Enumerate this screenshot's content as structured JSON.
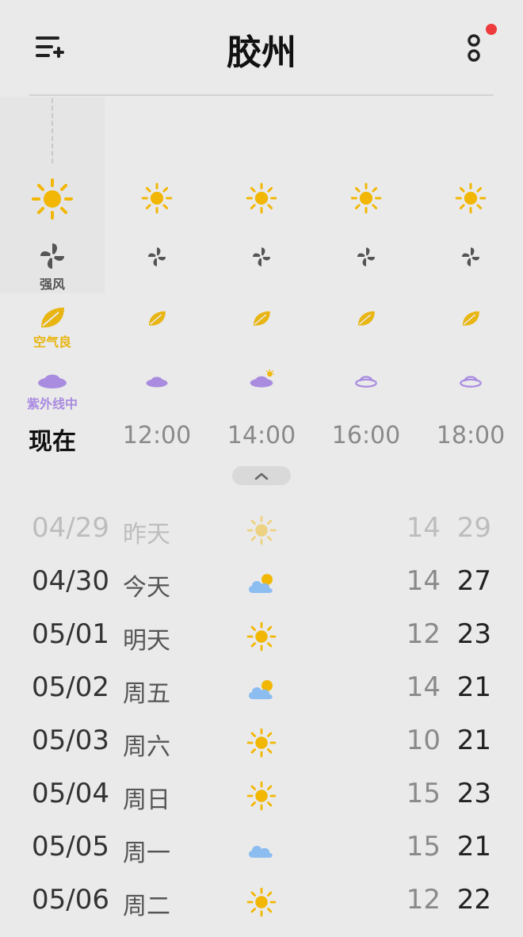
{
  "app": {
    "city": "胶州"
  },
  "hourly": [
    {
      "time": "现在",
      "wind": "强风",
      "air": "空气良",
      "uv": "紫外线中"
    },
    {
      "time": "12:00"
    },
    {
      "time": "14:00"
    },
    {
      "time": "16:00"
    },
    {
      "time": "18:00"
    }
  ],
  "daily": [
    {
      "date": "04/29",
      "day": "昨天",
      "icon": "sun-icon",
      "low": "14",
      "high": "29"
    },
    {
      "date": "04/30",
      "day": "今天",
      "icon": "cloud-sun-icon",
      "low": "14",
      "high": "27"
    },
    {
      "date": "05/01",
      "day": "明天",
      "icon": "sun-icon",
      "low": "12",
      "high": "23"
    },
    {
      "date": "05/02",
      "day": "周五",
      "icon": "cloud-sun-icon",
      "low": "14",
      "high": "21"
    },
    {
      "date": "05/03",
      "day": "周六",
      "icon": "sun-icon",
      "low": "10",
      "high": "21"
    },
    {
      "date": "05/04",
      "day": "周日",
      "icon": "sun-icon",
      "low": "15",
      "high": "23"
    },
    {
      "date": "05/05",
      "day": "周一",
      "icon": "cloud-icon",
      "low": "15",
      "high": "21"
    },
    {
      "date": "05/06",
      "day": "周二",
      "icon": "sun-icon",
      "low": "12",
      "high": "22"
    }
  ],
  "colors": {
    "sun": "#f2b705",
    "cloud": "#8cbdf0",
    "leaf": "#e8b512",
    "uv": "#a98ce0",
    "wind": "#555555",
    "notification": "#ee3b3b"
  }
}
